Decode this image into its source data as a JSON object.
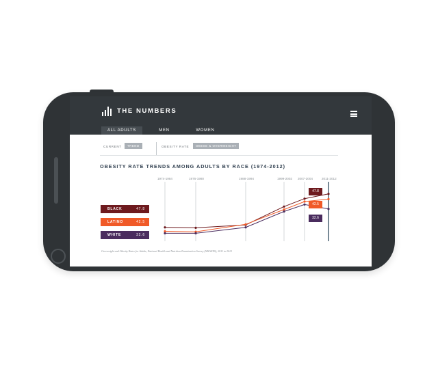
{
  "app": {
    "title": "THE NUMBERS",
    "logo_icon": "bar-chart-icon",
    "menu_icon": "hamburger-menu-icon"
  },
  "tabs": [
    {
      "label": "ALL ADULTS",
      "active": true
    },
    {
      "label": "MEN",
      "active": false
    },
    {
      "label": "WOMEN",
      "active": false
    }
  ],
  "filters": {
    "current_label": "CURRENT",
    "current_value": "TREND",
    "rate_label": "OBESITY RATE",
    "rate_value": "OBESE & OVERWEIGHT"
  },
  "chart_data": {
    "type": "line",
    "title": "OBESITY RATE TRENDS AMONG ADULTS BY RACE (1974-2012)",
    "categories": [
      "1974-1984",
      "1976-1980",
      "1988-1994",
      "1999-2002",
      "2007-2004",
      "2011-2012"
    ],
    "ylim": [
      0,
      60
    ],
    "series": [
      {
        "name": "BLACK",
        "color": "#6e1a1e",
        "values": [
          14.0,
          13.5,
          16.5,
          35.0,
          43.0,
          47.8
        ],
        "current": "47.8"
      },
      {
        "name": "LATINO",
        "color": "#f05a28",
        "values": [
          10.0,
          9.5,
          17.0,
          32.0,
          40.0,
          42.5
        ],
        "current": "42.5"
      },
      {
        "name": "WHITE",
        "color": "#4a2c5e",
        "values": [
          8.0,
          8.0,
          14.0,
          30.0,
          37.0,
          32.6
        ],
        "current": "32.6"
      }
    ],
    "highlight_category": "2011-2012",
    "grid": true,
    "legend": "left"
  },
  "footnote": "Overweight and Obesity Rates for Adults, National Health and Nutrition Examination Survey (NHANES), 2011 to 2012"
}
